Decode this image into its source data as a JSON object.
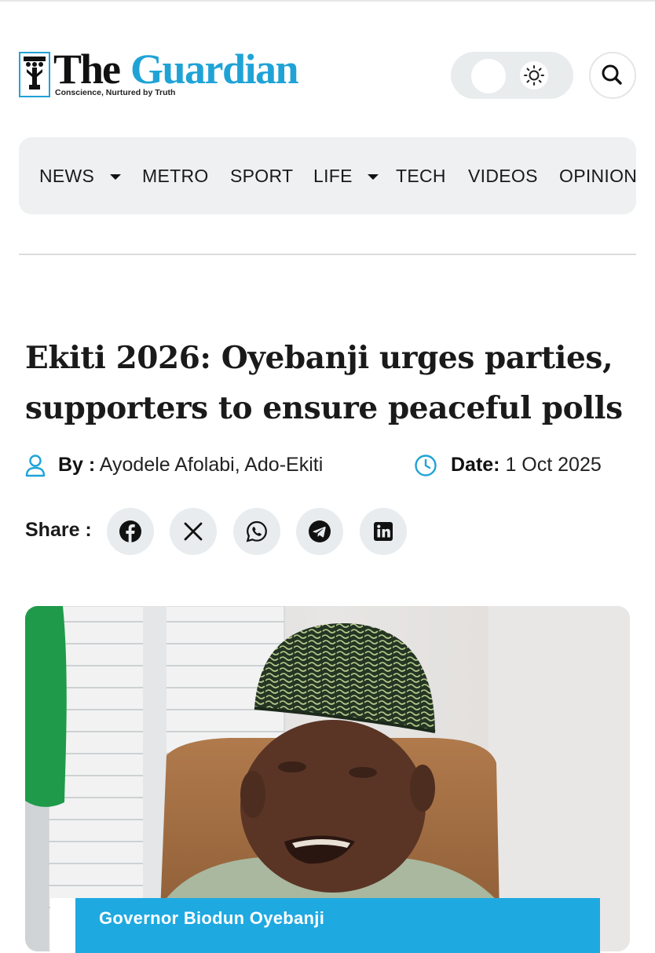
{
  "header": {
    "logo_the": "The",
    "logo_guardian": "Guardian",
    "tagline": "Conscience, Nurtured by Truth",
    "theme_toggle_icon": "sun-icon",
    "search_icon": "search-icon"
  },
  "nav": {
    "items": [
      {
        "label": "NEWS",
        "has_dropdown": true
      },
      {
        "label": "METRO",
        "has_dropdown": false
      },
      {
        "label": "SPORT",
        "has_dropdown": false
      },
      {
        "label": "LIFE",
        "has_dropdown": true
      },
      {
        "label": "TECH",
        "has_dropdown": false
      },
      {
        "label": "VIDEOS",
        "has_dropdown": false
      },
      {
        "label": "OPINION",
        "has_dropdown": false
      }
    ]
  },
  "article": {
    "headline": "Ekiti 2026: Oyebanji urges parties, supporters to ensure peaceful polls",
    "by_label": "By :",
    "author": " Ayodele Afolabi, Ado-Ekiti",
    "date_label": "Date:",
    "date": " 1 Oct 2025",
    "share_label": "Share :",
    "share_icons": [
      "facebook-icon",
      "x-icon",
      "whatsapp-icon",
      "telegram-icon",
      "linkedin-icon"
    ],
    "image_caption": "Governor Biodun Oyebanji"
  },
  "colors": {
    "brand_blue": "#1fa3d6",
    "caption_blue": "#1fa9e1",
    "nav_bg": "#eef0f1"
  }
}
